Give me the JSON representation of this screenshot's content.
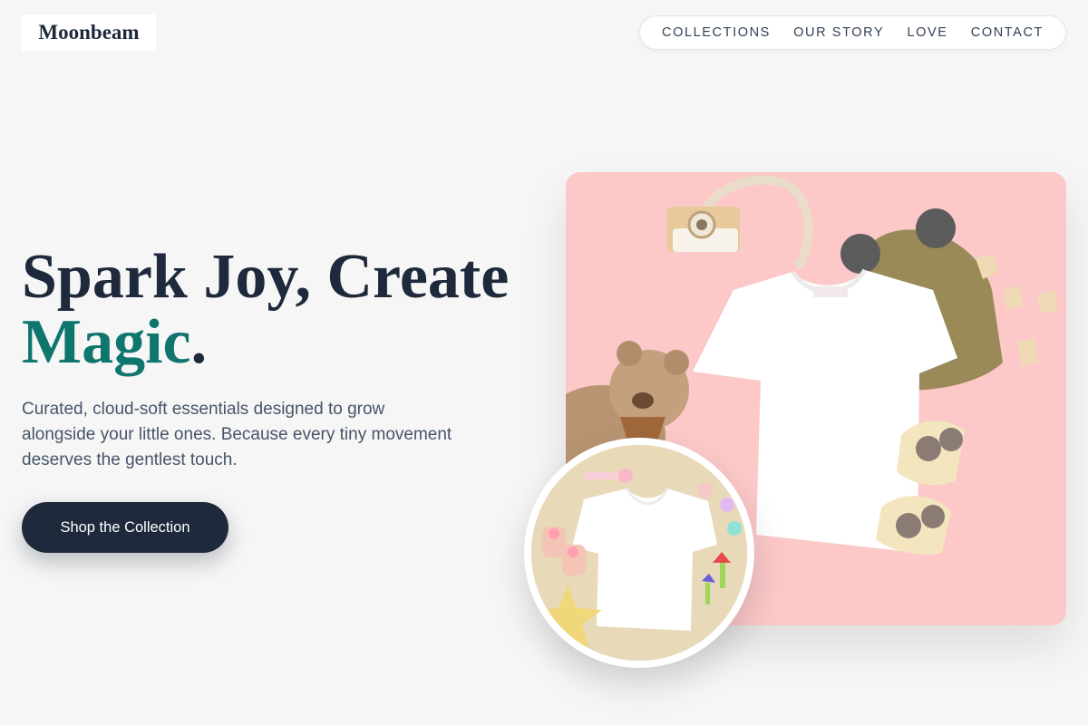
{
  "brand": {
    "name": "Moonbeam"
  },
  "nav": {
    "items": [
      {
        "label": "COLLECTIONS"
      },
      {
        "label": "OUR STORY"
      },
      {
        "label": "LOVE"
      },
      {
        "label": "CONTACT"
      }
    ]
  },
  "hero": {
    "headline_line1": "Spark Joy, Create",
    "headline_accent": "Magic",
    "headline_period": ".",
    "description": "Curated, cloud-soft essentials designed to grow alongside your little ones. Because every tiny movement deserves the gentlest touch.",
    "cta_label": "Shop the Collection"
  },
  "colors": {
    "background": "#f6f6f6",
    "primary_dark": "#1e293b",
    "accent_teal": "#0f766e",
    "hero_pink": "#fcc8c8",
    "circle_beige": "#e8d9b8"
  },
  "images": {
    "main": "flat-lay-white-baby-tshirt-with-teddy-bear-knit-hat-and-toy-camera",
    "secondary": "flat-lay-white-baby-tshirt-with-socks-and-toys"
  }
}
